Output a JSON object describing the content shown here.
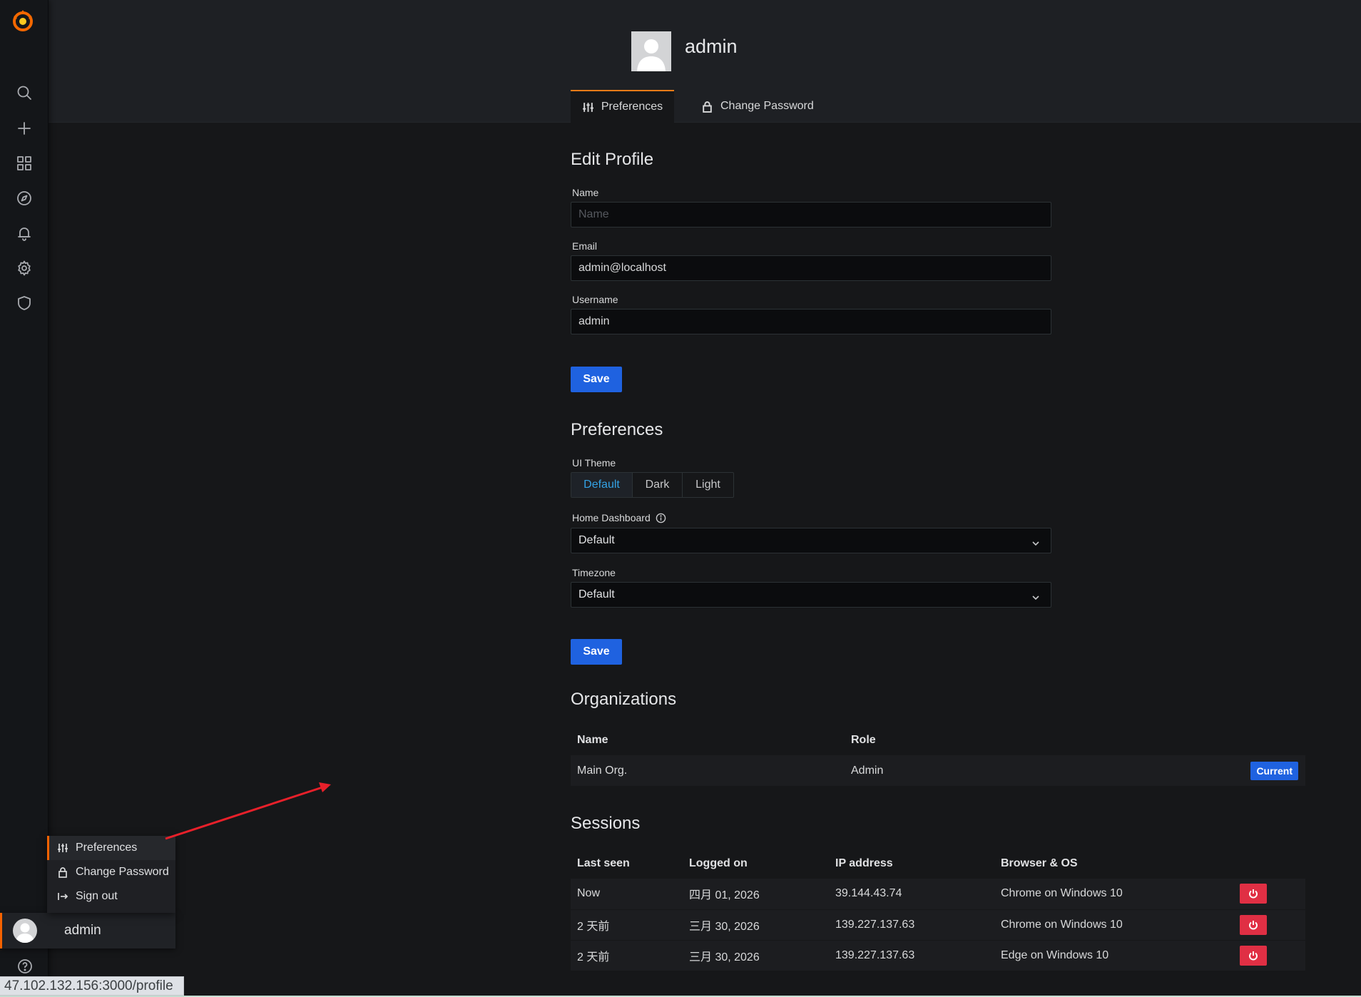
{
  "header": {
    "title": "admin"
  },
  "tabs": {
    "preferences": "Preferences",
    "change_password": "Change Password"
  },
  "edit_profile": {
    "heading": "Edit Profile",
    "name_label": "Name",
    "name_placeholder": "Name",
    "name_value": "",
    "email_label": "Email",
    "email_value": "admin@localhost",
    "username_label": "Username",
    "username_value": "admin",
    "save_label": "Save"
  },
  "preferences": {
    "heading": "Preferences",
    "theme_label": "UI Theme",
    "theme_options": [
      "Default",
      "Dark",
      "Light"
    ],
    "theme_selected": "Default",
    "home_dashboard_label": "Home Dashboard",
    "home_dashboard_value": "Default",
    "timezone_label": "Timezone",
    "timezone_value": "Default",
    "save_label": "Save"
  },
  "organizations": {
    "heading": "Organizations",
    "columns": [
      "Name",
      "Role"
    ],
    "rows": [
      {
        "name": "Main Org.",
        "role": "Admin",
        "badge": "Current"
      }
    ]
  },
  "sessions": {
    "heading": "Sessions",
    "columns": [
      "Last seen",
      "Logged on",
      "IP address",
      "Browser & OS"
    ],
    "rows": [
      {
        "last_seen": "Now",
        "logged_on": "四月 01, 2026",
        "ip": "39.144.43.74",
        "browser": "Chrome on Windows 10"
      },
      {
        "last_seen": "2 天前",
        "logged_on": "三月 30, 2026",
        "ip": "139.227.137.63",
        "browser": "Chrome on Windows 10"
      },
      {
        "last_seen": "2 天前",
        "logged_on": "三月 30, 2026",
        "ip": "139.227.137.63",
        "browser": "Edge on Windows 10"
      }
    ]
  },
  "sidebar": {
    "icons": [
      "search-icon",
      "plus-icon",
      "dashboards-icon",
      "explore-icon",
      "bell-icon",
      "gear-icon",
      "shield-icon"
    ],
    "profile_menu": [
      "Preferences",
      "Change Password",
      "Sign out"
    ],
    "user_name": "admin"
  },
  "status_url": "47.102.132.156:3000/profile",
  "colors": {
    "accent_orange": "#f56200",
    "primary_blue": "#1f62e0",
    "destructive_red": "#e02f44",
    "selected_text": "#33a2e5",
    "annotation_arrow": "#e8202a"
  }
}
